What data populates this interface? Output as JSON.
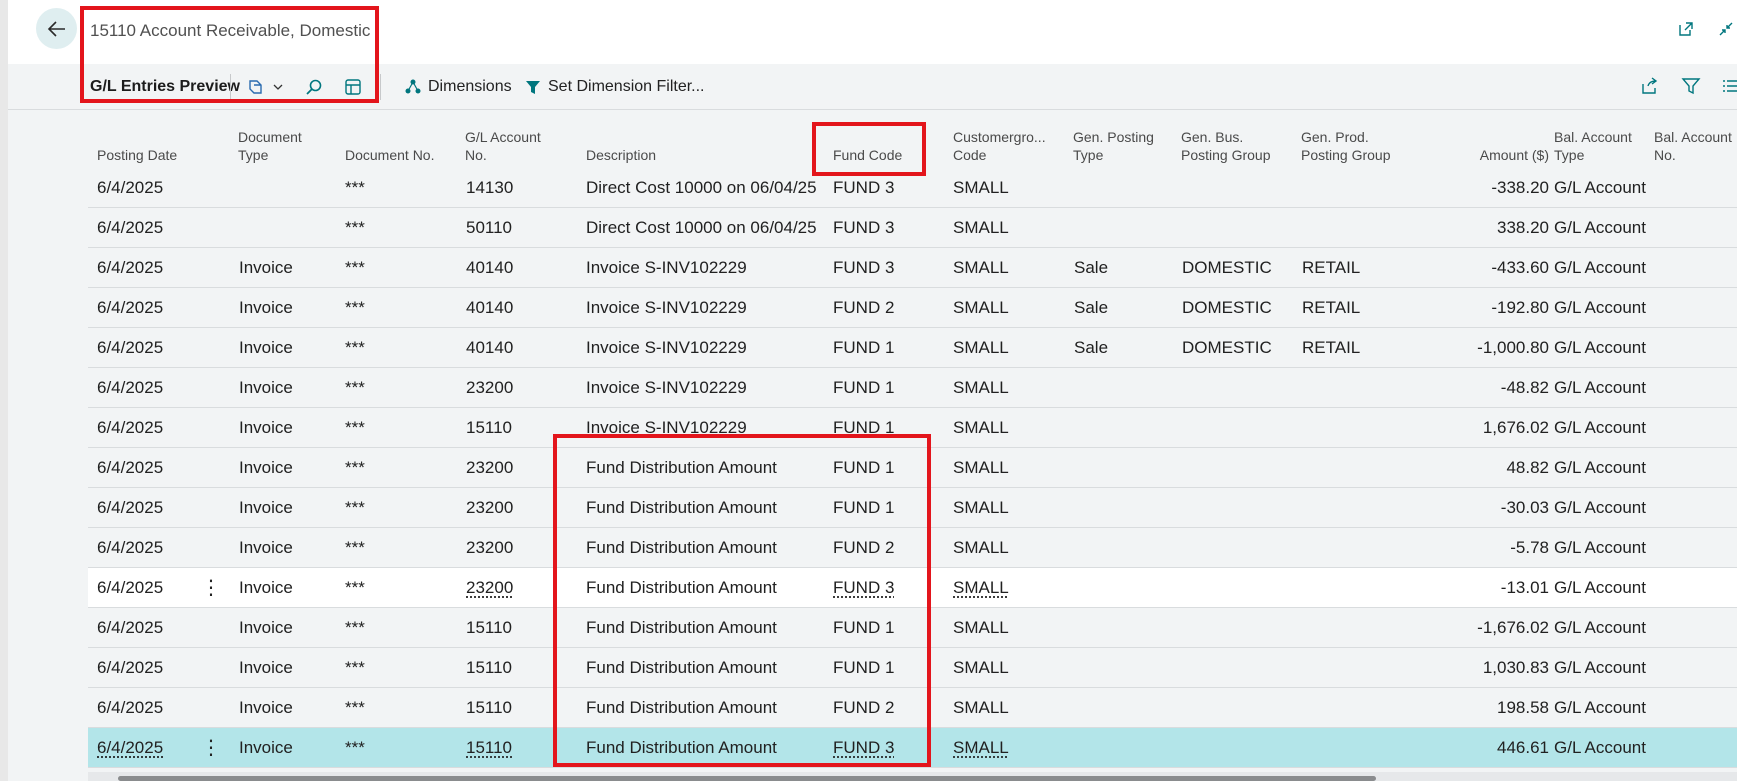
{
  "header": {
    "title": "15110 Account Receivable, Domestic",
    "back_icon": "arrow-left-icon",
    "icons": [
      "open-new-window-icon",
      "collapse-icon"
    ]
  },
  "toolbar": {
    "title": "G/L Entries Preview",
    "dimensions_label": "Dimensions",
    "set_filter_label": "Set Dimension Filter...",
    "icons": [
      "copilot-icon",
      "search-icon",
      "personalize-icon",
      "share-icon",
      "filter-icon",
      "list-icon"
    ]
  },
  "columns": {
    "posting_date": "Posting Date",
    "doc_type_1": "Document",
    "doc_type_2": "Type",
    "doc_no": "Document No.",
    "gl_acc_1": "G/L Account",
    "gl_acc_2": "No.",
    "description": "Description",
    "fund_code": "Fund Code",
    "custgrp_1": "Customergro...",
    "custgrp_2": "Code",
    "gen_post_1": "Gen. Posting",
    "gen_post_2": "Type",
    "gen_bus_1": "Gen. Bus.",
    "gen_bus_2": "Posting Group",
    "gen_prod_1": "Gen. Prod.",
    "gen_prod_2": "Posting Group",
    "amount": "Amount ($)",
    "bal_type_1": "Bal. Account",
    "bal_type_2": "Type",
    "bal_no_1": "Bal. Account",
    "bal_no_2": "No."
  },
  "rows": [
    {
      "date": "6/4/2025",
      "doc_type": "",
      "doc_no": "***",
      "acc": "14130",
      "desc": "Direct Cost 10000 on 06/04/25",
      "fund": "FUND 3",
      "cust": "SMALL",
      "gpt": "",
      "gbus": "",
      "gprod": "",
      "amount": "-338.20",
      "bal_type": "G/L Account"
    },
    {
      "date": "6/4/2025",
      "doc_type": "",
      "doc_no": "***",
      "acc": "50110",
      "desc": "Direct Cost 10000 on 06/04/25",
      "fund": "FUND 3",
      "cust": "SMALL",
      "gpt": "",
      "gbus": "",
      "gprod": "",
      "amount": "338.20",
      "bal_type": "G/L Account"
    },
    {
      "date": "6/4/2025",
      "doc_type": "Invoice",
      "doc_no": "***",
      "acc": "40140",
      "desc": "Invoice S-INV102229",
      "fund": "FUND 3",
      "cust": "SMALL",
      "gpt": "Sale",
      "gbus": "DOMESTIC",
      "gprod": "RETAIL",
      "amount": "-433.60",
      "bal_type": "G/L Account"
    },
    {
      "date": "6/4/2025",
      "doc_type": "Invoice",
      "doc_no": "***",
      "acc": "40140",
      "desc": "Invoice S-INV102229",
      "fund": "FUND 2",
      "cust": "SMALL",
      "gpt": "Sale",
      "gbus": "DOMESTIC",
      "gprod": "RETAIL",
      "amount": "-192.80",
      "bal_type": "G/L Account"
    },
    {
      "date": "6/4/2025",
      "doc_type": "Invoice",
      "doc_no": "***",
      "acc": "40140",
      "desc": "Invoice S-INV102229",
      "fund": "FUND 1",
      "cust": "SMALL",
      "gpt": "Sale",
      "gbus": "DOMESTIC",
      "gprod": "RETAIL",
      "amount": "-1,000.80",
      "bal_type": "G/L Account"
    },
    {
      "date": "6/4/2025",
      "doc_type": "Invoice",
      "doc_no": "***",
      "acc": "23200",
      "desc": "Invoice S-INV102229",
      "fund": "FUND 1",
      "cust": "SMALL",
      "gpt": "",
      "gbus": "",
      "gprod": "",
      "amount": "-48.82",
      "bal_type": "G/L Account"
    },
    {
      "date": "6/4/2025",
      "doc_type": "Invoice",
      "doc_no": "***",
      "acc": "15110",
      "desc": "Invoice S-INV102229",
      "fund": "FUND 1",
      "cust": "SMALL",
      "gpt": "",
      "gbus": "",
      "gprod": "",
      "amount": "1,676.02",
      "bal_type": "G/L Account"
    },
    {
      "date": "6/4/2025",
      "doc_type": "Invoice",
      "doc_no": "***",
      "acc": "23200",
      "desc": "Fund Distribution Amount",
      "fund": "FUND 1",
      "cust": "SMALL",
      "gpt": "",
      "gbus": "",
      "gprod": "",
      "amount": "48.82",
      "bal_type": "G/L Account"
    },
    {
      "date": "6/4/2025",
      "doc_type": "Invoice",
      "doc_no": "***",
      "acc": "23200",
      "desc": "Fund Distribution Amount",
      "fund": "FUND 1",
      "cust": "SMALL",
      "gpt": "",
      "gbus": "",
      "gprod": "",
      "amount": "-30.03",
      "bal_type": "G/L Account"
    },
    {
      "date": "6/4/2025",
      "doc_type": "Invoice",
      "doc_no": "***",
      "acc": "23200",
      "desc": "Fund Distribution Amount",
      "fund": "FUND 2",
      "cust": "SMALL",
      "gpt": "",
      "gbus": "",
      "gprod": "",
      "amount": "-5.78",
      "bal_type": "G/L Account"
    },
    {
      "date": "6/4/2025",
      "doc_type": "Invoice",
      "doc_no": "***",
      "acc": "23200",
      "desc": "Fund Distribution Amount",
      "fund": "FUND 3",
      "cust": "SMALL",
      "gpt": "",
      "gbus": "",
      "gprod": "",
      "amount": "-13.01",
      "bal_type": "G/L Account"
    },
    {
      "date": "6/4/2025",
      "doc_type": "Invoice",
      "doc_no": "***",
      "acc": "15110",
      "desc": "Fund Distribution Amount",
      "fund": "FUND 1",
      "cust": "SMALL",
      "gpt": "",
      "gbus": "",
      "gprod": "",
      "amount": "-1,676.02",
      "bal_type": "G/L Account"
    },
    {
      "date": "6/4/2025",
      "doc_type": "Invoice",
      "doc_no": "***",
      "acc": "15110",
      "desc": "Fund Distribution Amount",
      "fund": "FUND 1",
      "cust": "SMALL",
      "gpt": "",
      "gbus": "",
      "gprod": "",
      "amount": "1,030.83",
      "bal_type": "G/L Account"
    },
    {
      "date": "6/4/2025",
      "doc_type": "Invoice",
      "doc_no": "***",
      "acc": "15110",
      "desc": "Fund Distribution Amount",
      "fund": "FUND 2",
      "cust": "SMALL",
      "gpt": "",
      "gbus": "",
      "gprod": "",
      "amount": "198.58",
      "bal_type": "G/L Account"
    },
    {
      "date": "6/4/2025",
      "doc_type": "Invoice",
      "doc_no": "***",
      "acc": "15110",
      "desc": "Fund Distribution Amount",
      "fund": "FUND 3",
      "cust": "SMALL",
      "gpt": "",
      "gbus": "",
      "gprod": "",
      "amount": "446.61",
      "bal_type": "G/L Account"
    }
  ],
  "colors": {
    "accent": "#00767e",
    "highlight_box": "#e3151c",
    "selected_row": "#b3e5e9"
  }
}
